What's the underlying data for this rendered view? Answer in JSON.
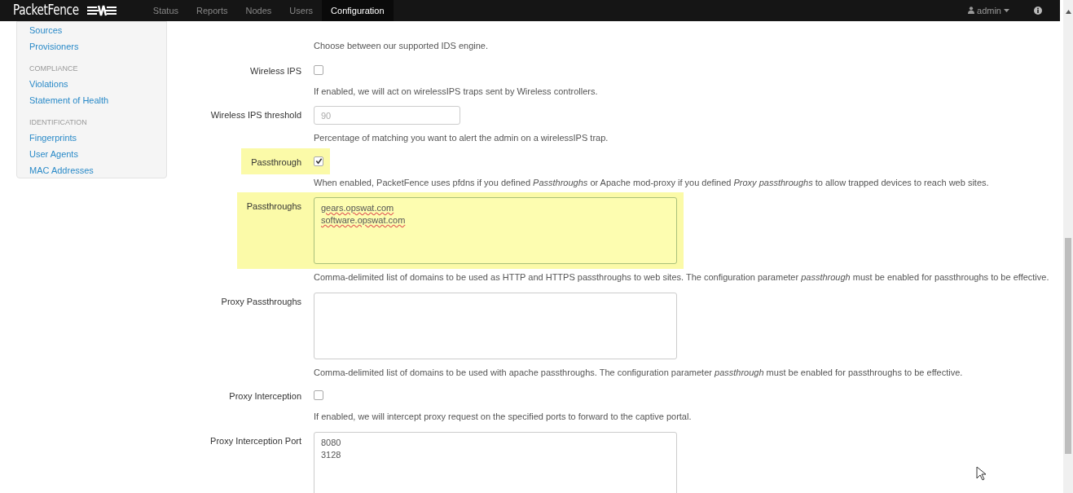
{
  "navbar": {
    "brand": "PacketFence",
    "items": [
      {
        "label": "Status",
        "selected": false
      },
      {
        "label": "Reports",
        "selected": false
      },
      {
        "label": "Nodes",
        "selected": false
      },
      {
        "label": "Users",
        "selected": false
      },
      {
        "label": "Configuration",
        "selected": true
      }
    ],
    "user": "admin"
  },
  "sidebar": {
    "groups": [
      {
        "items": [
          "Sources",
          "Provisioners"
        ]
      },
      {
        "title": "COMPLIANCE",
        "items": [
          "Violations",
          "Statement of Health"
        ]
      },
      {
        "title": "IDENTIFICATION",
        "items": [
          "Fingerprints",
          "User Agents",
          "MAC Addresses"
        ]
      }
    ]
  },
  "form": {
    "intro_help": "Choose between our supported IDS engine.",
    "rows": [
      {
        "kind": "checkbox",
        "label": "Wireless IPS",
        "checked": false,
        "highlighted": false,
        "help": "If enabled, we will act on wirelessIPS traps sent by Wireless controllers."
      },
      {
        "kind": "text",
        "label": "Wireless IPS threshold",
        "placeholder": "90",
        "highlighted": false,
        "help": "Percentage of matching you want to alert the admin on a wirelessIPS trap."
      },
      {
        "kind": "checkbox",
        "label": "Passthrough",
        "checked": true,
        "highlighted": true,
        "help": "When enabled, PacketFence uses pfdns if you defined *Passthroughs* or Apache mod-proxy if you defined *Proxy passthroughs* to allow trapped devices to reach web sites."
      },
      {
        "kind": "textarea",
        "label": "Passthroughs",
        "lines": [
          "gears.opswat.com",
          "software.opswat.com"
        ],
        "highlighted": true,
        "help": "Comma-delimited list of domains to be used as HTTP and HTTPS passthroughs to web sites. The configuration parameter *passthrough* must be enabled for passthroughs to be effective."
      },
      {
        "kind": "textarea",
        "label": "Proxy Passthroughs",
        "lines": [],
        "highlighted": false,
        "help": "Comma-delimited list of domains to be used with apache passthroughs. The configuration parameter *passthrough* must be enabled for passthroughs to be effective."
      },
      {
        "kind": "checkbox",
        "label": "Proxy Interception",
        "checked": false,
        "highlighted": false,
        "help": "If enabled, we will intercept proxy request on the specified ports to forward to the captive portal."
      },
      {
        "kind": "textarea",
        "label": "Proxy Interception Port",
        "lines": [
          "8080",
          "3128"
        ],
        "highlighted": false
      }
    ]
  }
}
